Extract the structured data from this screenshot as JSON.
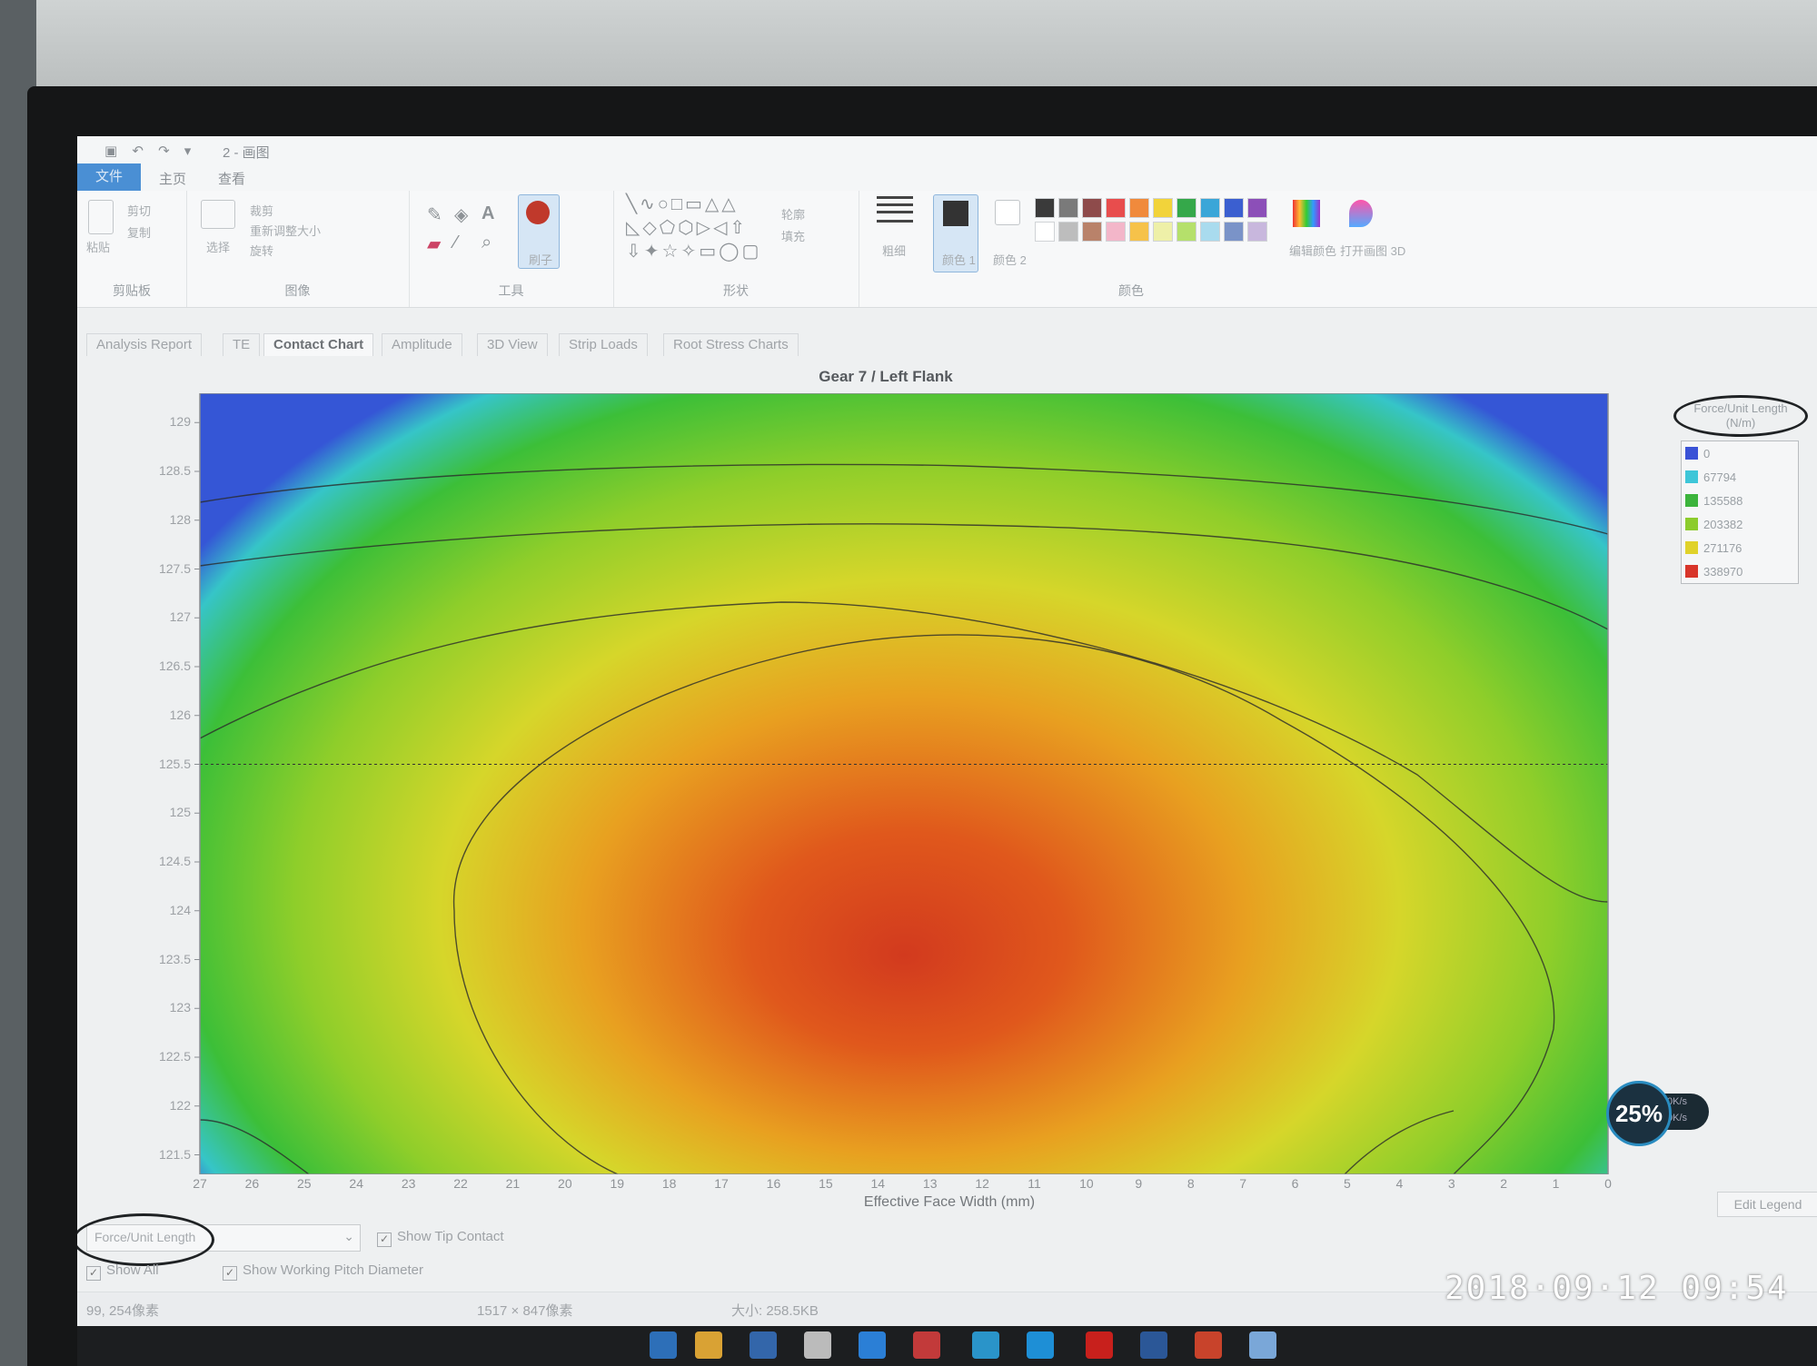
{
  "window": {
    "title": "2 - 画图",
    "menu": [
      "文件",
      "主页",
      "查看"
    ]
  },
  "ribbon": {
    "groups": [
      {
        "label": "剪贴板",
        "items": [
          "粘贴",
          "剪切",
          "复制"
        ]
      },
      {
        "label": "图像",
        "items": [
          "选择",
          "裁剪",
          "重新调整大小",
          "旋转"
        ]
      },
      {
        "label": "工具",
        "items": [
          "刷子"
        ]
      },
      {
        "label": "形状",
        "items": [
          "轮廓",
          "填充"
        ]
      },
      {
        "label": "颜色",
        "items": [
          "粗细",
          "颜色 1",
          "颜色 2",
          "编辑颜色",
          "打开画图 3D"
        ]
      }
    ],
    "palette_row1": [
      "#3a3a3a",
      "#7a7a7a",
      "#8e4b4b",
      "#e84d4d",
      "#f08a3c",
      "#f2d33a",
      "#35a84a",
      "#3aa6d8",
      "#3b5fd0",
      "#8c4fb8"
    ],
    "palette_row2": [
      "#ffffff",
      "#bdbdbd",
      "#b9826a",
      "#f3b6c9",
      "#f6c24a",
      "#eef0a8",
      "#b5e06b",
      "#a9dbee",
      "#7a93c8",
      "#c8b7dd"
    ]
  },
  "tabs": [
    "Analysis Report",
    "TE",
    "Contact Chart",
    "Amplitude",
    "3D View",
    "Strip Loads",
    "Root Stress Charts"
  ],
  "active_tab": "Contact Chart",
  "chart_data": {
    "type": "heatmap",
    "title": "Gear 7 / Left Flank",
    "xlabel": "Effective Face Width (mm)",
    "ylabel": "",
    "x_ticks": [
      27,
      26,
      25,
      24,
      23,
      22,
      21,
      20,
      19,
      18,
      17,
      16,
      15,
      14,
      13,
      12,
      11,
      10,
      9,
      8,
      7,
      6,
      5,
      4,
      3,
      2,
      1,
      0
    ],
    "y_ticks": [
      129,
      128.5,
      128,
      127.5,
      127,
      126.5,
      126,
      125.5,
      125,
      124.5,
      124,
      123.5,
      123,
      122.5,
      122,
      121.5
    ],
    "xlim": [
      27,
      0
    ],
    "ylim": [
      121.3,
      129.3
    ],
    "working_pitch_diameter_line": 125.5,
    "legend_title": "Force/Unit Length (N/m)",
    "legend": [
      {
        "value": "0",
        "color": "#3a52d6"
      },
      {
        "value": "67794",
        "color": "#3ec6d8"
      },
      {
        "value": "135588",
        "color": "#3cb43c"
      },
      {
        "value": "203382",
        "color": "#8ccc2c"
      },
      {
        "value": "271176",
        "color": "#e0d22a"
      },
      {
        "value": "338970",
        "color": "#d8352a"
      }
    ]
  },
  "controls": {
    "result_select": "Force/Unit Length",
    "show_tip_contact": "Show Tip Contact",
    "show_all": "Show All",
    "show_working_pitch_diameter": "Show Working Pitch Diameter",
    "edit_legend": "Edit Legend"
  },
  "status": {
    "cursor": "99, 254像素",
    "dimensions": "1517 × 847像素",
    "size": "大小: 258.5KB"
  },
  "overlay": {
    "timestamp": "2018·09·12  09:54",
    "speed_percent": "25%",
    "up": "0K/s",
    "down": "0K/s"
  }
}
